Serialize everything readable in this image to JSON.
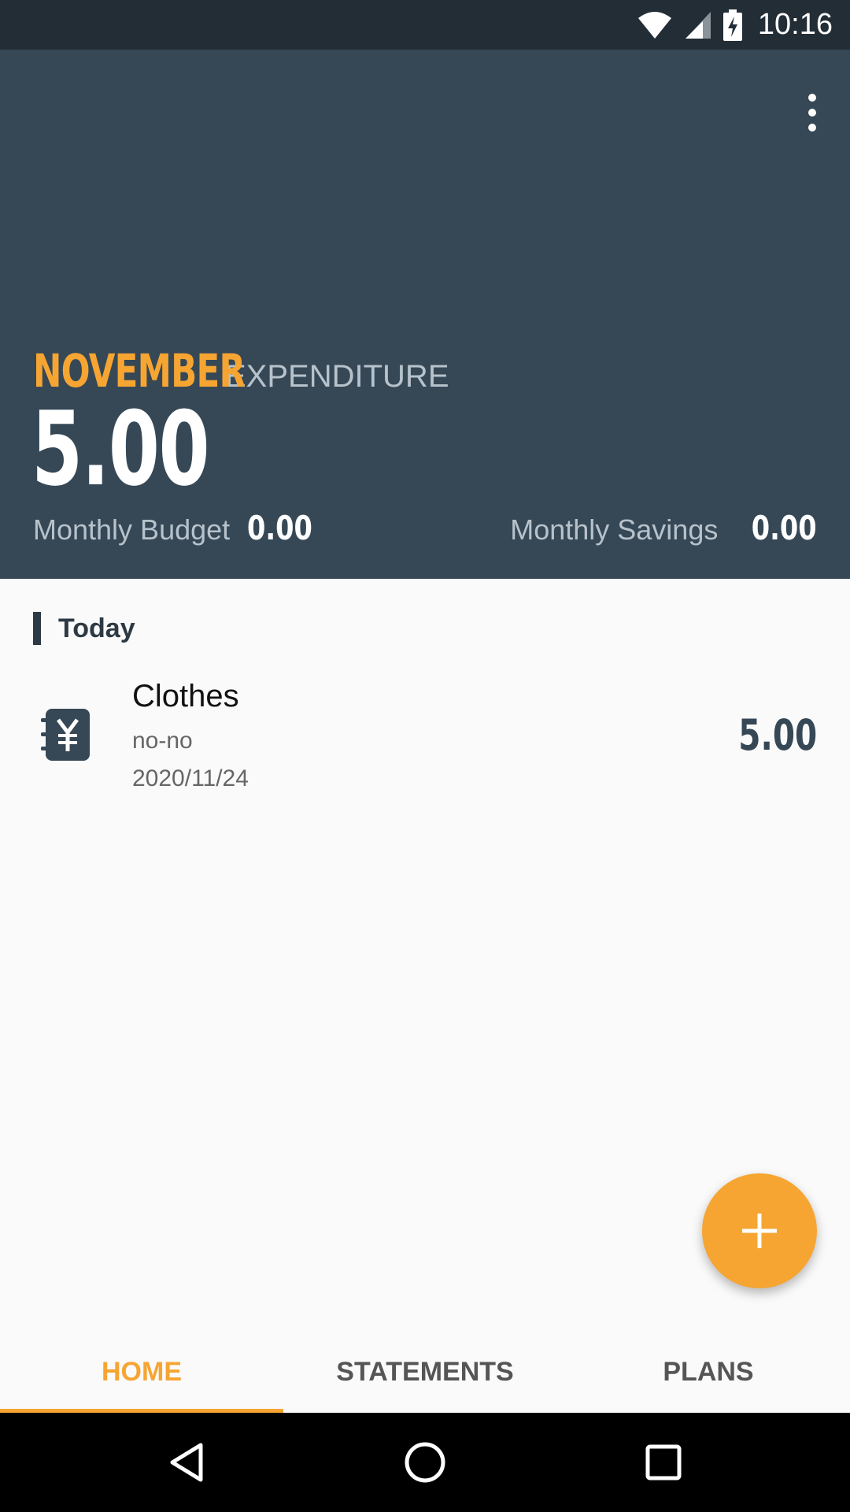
{
  "status_bar": {
    "time": "10:16"
  },
  "header": {
    "month": "NOVEMBER",
    "label": "EXPENDITURE",
    "total": "5.00",
    "budget_label": "Monthly Budget",
    "budget_value": "0.00",
    "savings_label": "Monthly Savings",
    "savings_value": "0.00"
  },
  "section": {
    "title": "Today"
  },
  "entries": [
    {
      "title": "Clothes",
      "subtitle": "no-no",
      "date": "2020/11/24",
      "amount": "5.00",
      "icon": "yen-notebook-icon"
    }
  ],
  "tabs": [
    {
      "label": "HOME",
      "active": true
    },
    {
      "label": "STATEMENTS",
      "active": false
    },
    {
      "label": "PLANS",
      "active": false
    }
  ],
  "colors": {
    "accent": "#f6a532",
    "header_bg": "#364856",
    "status_bg": "#232d36"
  }
}
